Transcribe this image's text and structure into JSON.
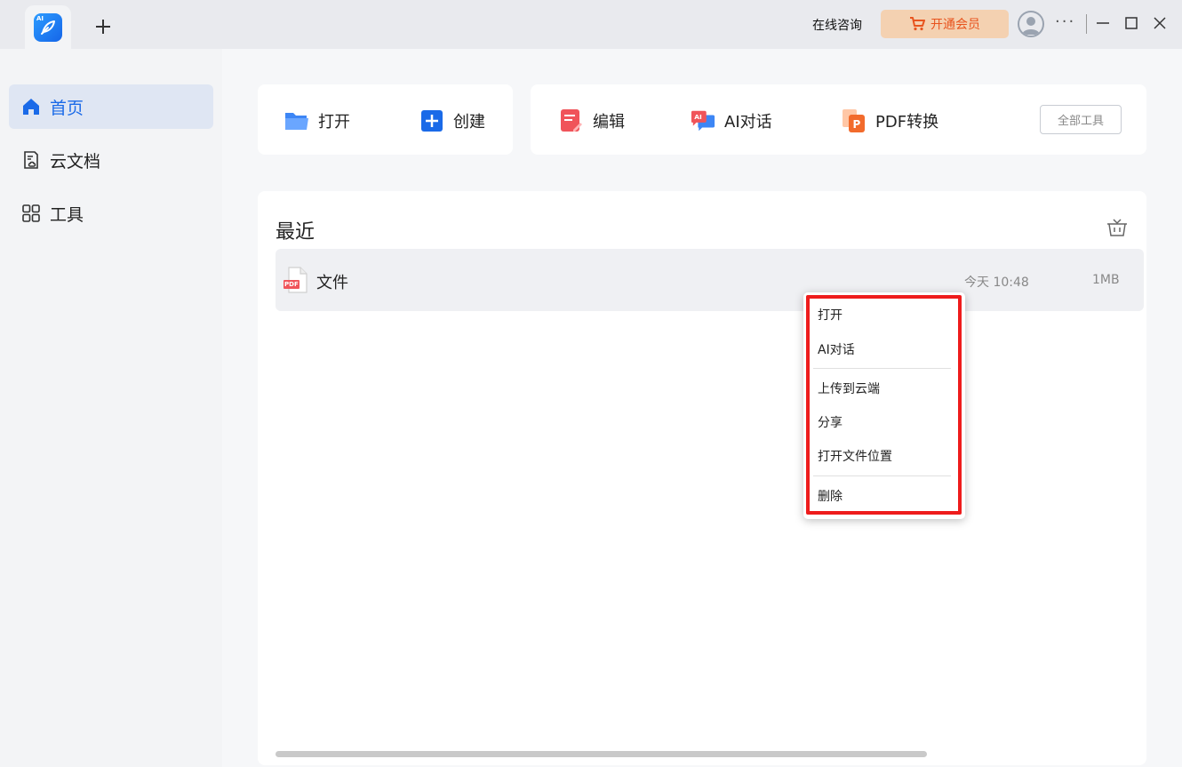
{
  "titlebar": {
    "consult_label": "在线咨询",
    "vip_label": "开通会员",
    "more_label": "···",
    "app_logo_tag": "AI"
  },
  "sidebar": {
    "items": [
      {
        "label": "首页",
        "icon": "home-icon",
        "active": true
      },
      {
        "label": "云文档",
        "icon": "cloud-doc-icon",
        "active": false
      },
      {
        "label": "工具",
        "icon": "grid-icon",
        "active": false
      }
    ]
  },
  "quick_tools": {
    "open": "打开",
    "create": "创建",
    "edit": "编辑",
    "ai_chat": "AI对话",
    "pdf_convert": "PDF转换",
    "all_tools": "全部工具"
  },
  "recent": {
    "title": "最近",
    "files": [
      {
        "name": "文件",
        "time": "今天 10:48",
        "size": "1MB",
        "type_badge": "PDF"
      }
    ]
  },
  "context_menu": {
    "items": [
      "打开",
      "AI对话",
      "上传到云端",
      "分享",
      "打开文件位置",
      "删除"
    ]
  },
  "colors": {
    "accent": "#1a6ae8",
    "vip_bg": "#f4d1b1",
    "vip_text": "#e8541e",
    "highlight_red": "#ee1c1c"
  }
}
